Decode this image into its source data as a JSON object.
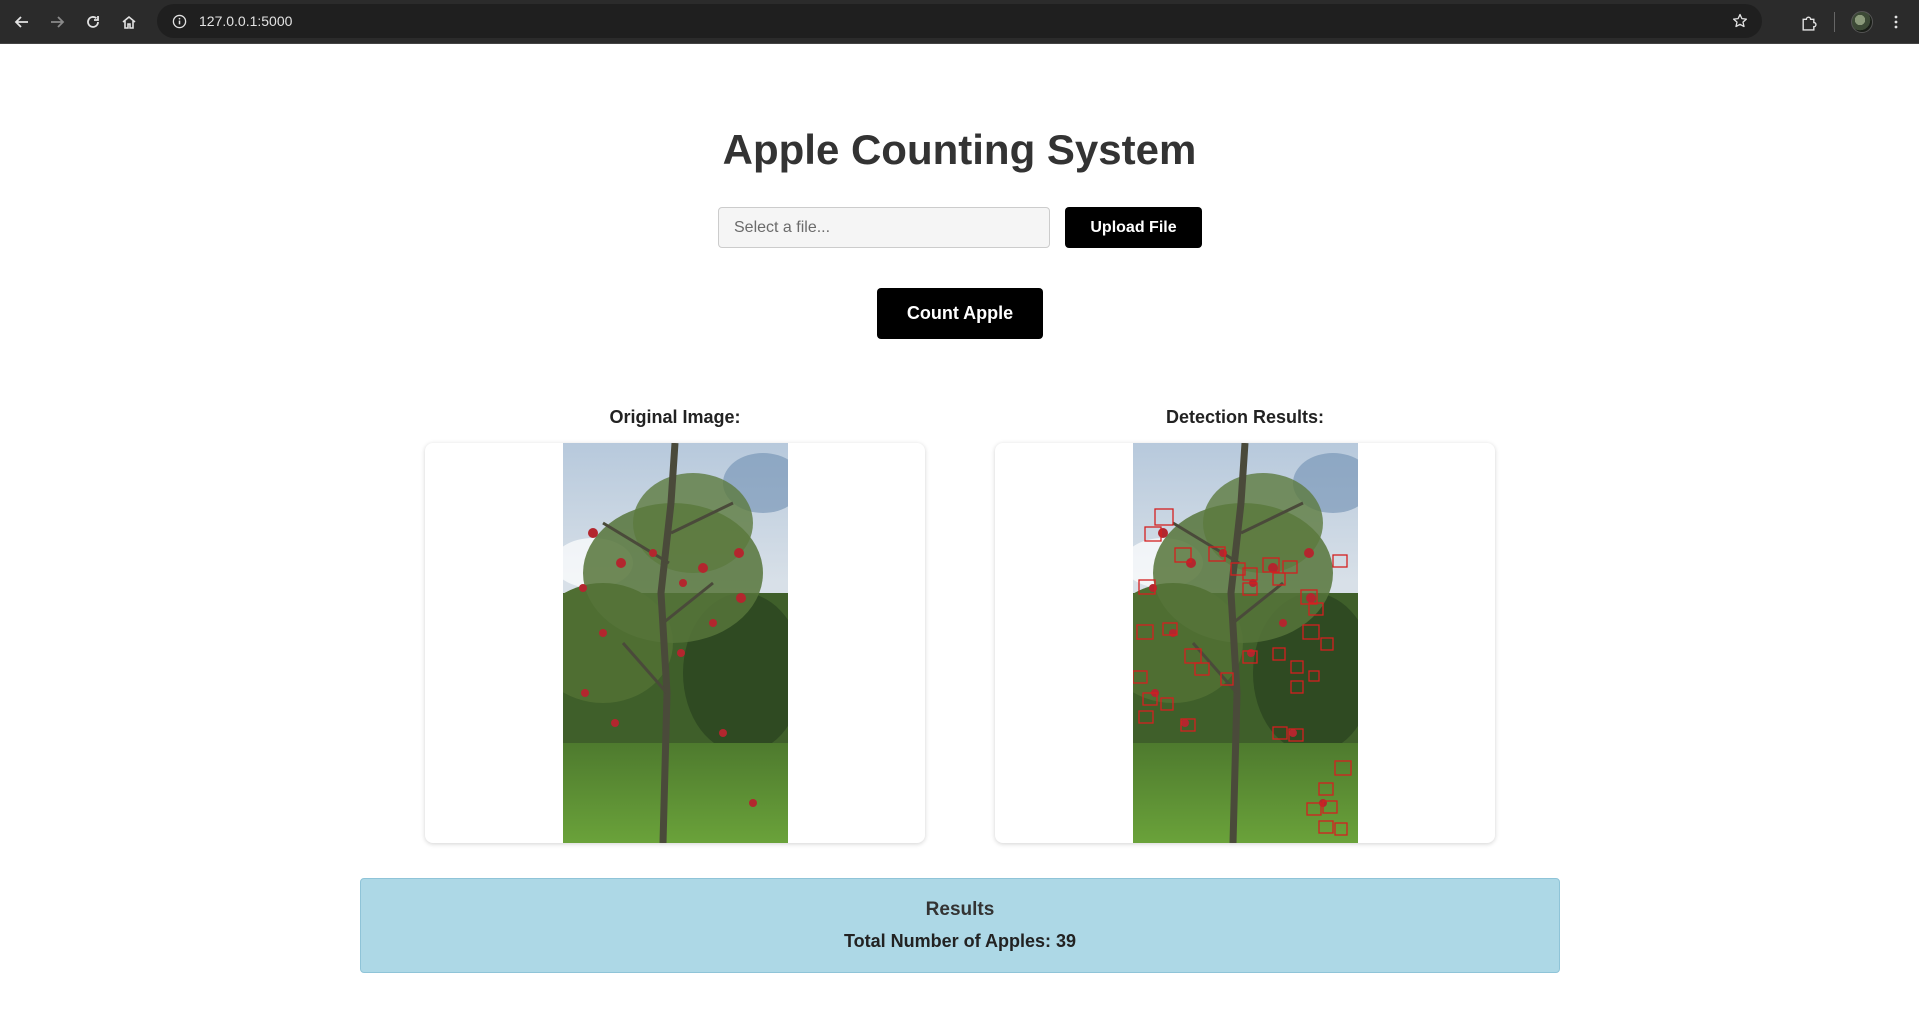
{
  "browser": {
    "url": "127.0.0.1:5000"
  },
  "app": {
    "title": "Apple Counting System"
  },
  "upload": {
    "placeholder": "Select a file...",
    "button_label": "Upload File"
  },
  "count": {
    "button_label": "Count Apple"
  },
  "panels": {
    "original_label": "Original Image:",
    "detection_label": "Detection Results:"
  },
  "results": {
    "title": "Results",
    "total_label": "Total Number of Apples:",
    "total_value": "39"
  }
}
